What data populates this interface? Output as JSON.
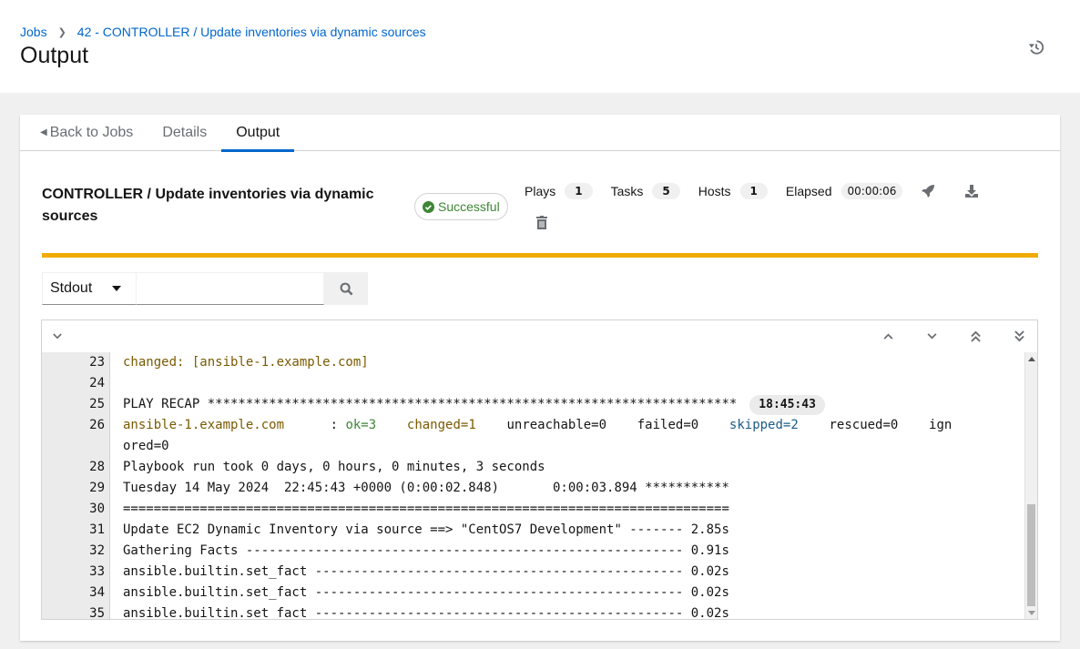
{
  "breadcrumb": {
    "items": [
      "Jobs",
      "42 - CONTROLLER / Update inventories via dynamic sources"
    ]
  },
  "page_title": "Output",
  "tabs": [
    {
      "label": "Back to Jobs",
      "active": false
    },
    {
      "label": "Details",
      "active": false
    },
    {
      "label": "Output",
      "active": true
    }
  ],
  "job": {
    "title": "CONTROLLER / Update inventories via dynamic sources",
    "status": "Successful",
    "stats": {
      "plays_label": "Plays",
      "plays": "1",
      "tasks_label": "Tasks",
      "tasks": "5",
      "hosts_label": "Hosts",
      "hosts": "1",
      "elapsed_label": "Elapsed",
      "elapsed": "00:00:06"
    }
  },
  "colors": {
    "accent": "#0066cc",
    "status_bar": "#f0ab00",
    "success": "#3e8635",
    "changed": "#7a5a00",
    "skipped": "#1c5b87"
  },
  "toolbar": {
    "filter_selected": "Stdout",
    "search_value": "",
    "search_placeholder": ""
  },
  "icons": {
    "history": "history-icon",
    "relaunch": "rocket-icon",
    "download": "download-icon",
    "delete": "trash-icon",
    "search": "search-icon",
    "expand": "chevron-down-icon",
    "scroll_up": "angle-up-icon",
    "scroll_down": "angle-down-icon",
    "scroll_top": "angle-double-up-icon",
    "scroll_bottom": "angle-double-down-icon"
  },
  "output": {
    "lines": [
      {
        "num": "23",
        "parts": [
          {
            "text": "changed: [ansible-1.example.com]",
            "style": "changed"
          }
        ]
      },
      {
        "num": "24",
        "parts": []
      },
      {
        "num": "25",
        "parts": [
          {
            "text": "PLAY RECAP *********************************************************************",
            "style": ""
          }
        ],
        "time": "18:45:43"
      },
      {
        "num": "26",
        "parts": [
          {
            "text": "ansible-1.example.com",
            "style": "changed"
          },
          {
            "text": "      : ",
            "style": ""
          },
          {
            "text": "ok=3",
            "style": "ok"
          },
          {
            "text": "    ",
            "style": ""
          },
          {
            "text": "changed=1",
            "style": "changed"
          },
          {
            "text": "    unreachable=0    failed=0    ",
            "style": ""
          },
          {
            "text": "skipped=2",
            "style": "skipped"
          },
          {
            "text": "    rescued=0    ign",
            "style": ""
          }
        ]
      },
      {
        "num": "",
        "parts": [
          {
            "text": "ored=0",
            "style": ""
          }
        ]
      },
      {
        "num": "28",
        "parts": [
          {
            "text": "Playbook run took 0 days, 0 hours, 0 minutes, 3 seconds",
            "style": ""
          }
        ]
      },
      {
        "num": "29",
        "parts": [
          {
            "text": "Tuesday 14 May 2024  22:45:43 +0000 (0:00:02.848)       0:00:03.894 ***********",
            "style": ""
          }
        ]
      },
      {
        "num": "30",
        "parts": [
          {
            "text": "===============================================================================",
            "style": ""
          }
        ]
      },
      {
        "num": "31",
        "parts": [
          {
            "text": "Update EC2 Dynamic Inventory via source ==> \"CentOS7 Development\" ------- 2.85s",
            "style": ""
          }
        ]
      },
      {
        "num": "32",
        "parts": [
          {
            "text": "Gathering Facts --------------------------------------------------------- 0.91s",
            "style": ""
          }
        ]
      },
      {
        "num": "33",
        "parts": [
          {
            "text": "ansible.builtin.set_fact ------------------------------------------------ 0.02s",
            "style": ""
          }
        ]
      },
      {
        "num": "34",
        "parts": [
          {
            "text": "ansible.builtin.set_fact ------------------------------------------------ 0.02s",
            "style": ""
          }
        ]
      },
      {
        "num": "35",
        "parts": [
          {
            "text": "ansible.builtin.set_fact ------------------------------------------------ 0.02s",
            "style": ""
          }
        ]
      }
    ]
  }
}
